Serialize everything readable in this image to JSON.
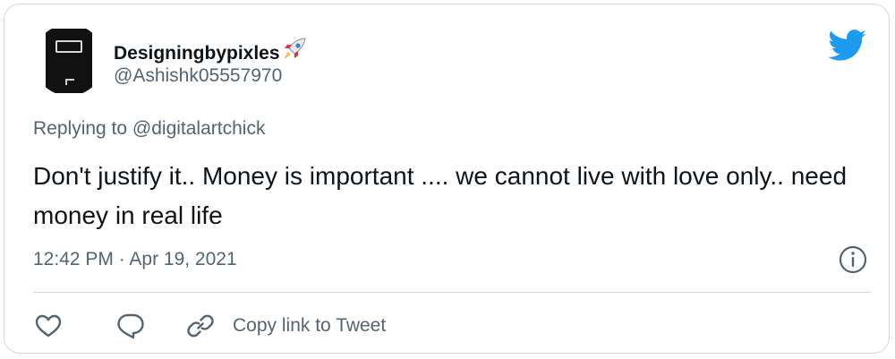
{
  "tweet": {
    "display_name": "Designingbypixles",
    "name_emoji": "rocket-emoji",
    "handle": "@Ashishk05557970",
    "replying_prefix": "Replying to",
    "replying_to": "@digitalartchick",
    "text": "Don't justify it.. Money is important .... we cannot live with love only.. need money in real life",
    "timestamp": "12:42 PM · Apr 19, 2021"
  },
  "actions": {
    "like_icon": "heart-icon",
    "reply_icon": "speech-bubble-icon",
    "copy_icon": "link-icon",
    "copy_label": "Copy link to Tweet"
  },
  "colors": {
    "twitter_blue": "#1d9bf0",
    "secondary_text": "#536471",
    "primary_text": "#0f1419",
    "border": "#cfd9de"
  }
}
